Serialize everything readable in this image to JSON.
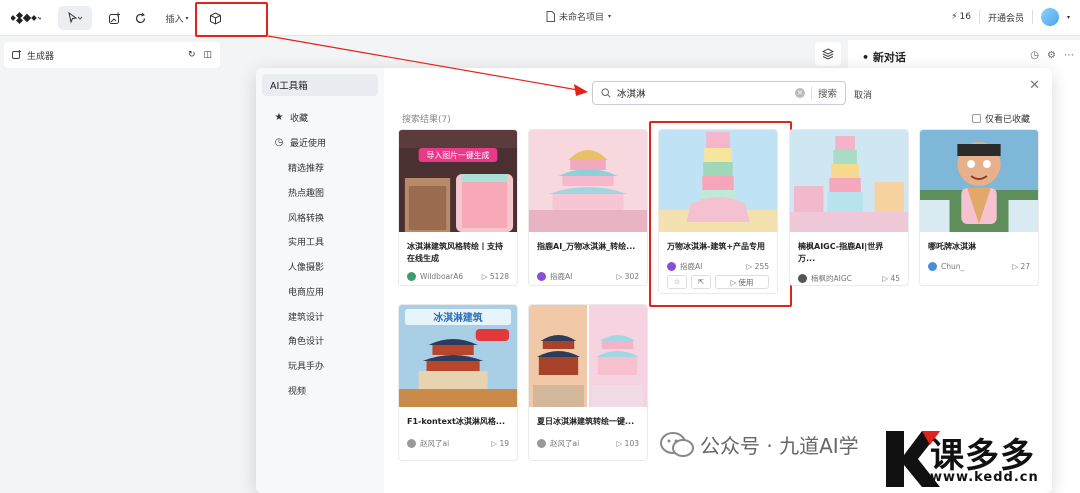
{
  "topbar": {
    "insert_label": "插入",
    "project_title": "未命名项目",
    "credits": "16",
    "vip_label": "开通会员"
  },
  "generator": {
    "label": "生成器"
  },
  "chat": {
    "title": "新对话"
  },
  "modal": {
    "sidebar_title": "AI工具箱",
    "sidebar_items": [
      {
        "label": "收藏",
        "icon": "star-icon"
      },
      {
        "label": "最近使用",
        "icon": "clock-icon"
      },
      {
        "label": "精选推荐"
      },
      {
        "label": "热点趣图"
      },
      {
        "label": "风格转换"
      },
      {
        "label": "实用工具"
      },
      {
        "label": "人像摄影"
      },
      {
        "label": "电商应用"
      },
      {
        "label": "建筑设计"
      },
      {
        "label": "角色设计"
      },
      {
        "label": "玩具手办"
      },
      {
        "label": "视频"
      }
    ],
    "search": {
      "value": "冰淇淋",
      "button": "搜索"
    },
    "cancel": "取消",
    "results_label": "搜索结果(7)",
    "only_favorites": "仅看已收藏",
    "cards": [
      {
        "title": "冰淇淋建筑风格转绘丨支持在线生成",
        "author": "WildboarA6",
        "plays": "5128",
        "thumb_text": "导入图片一键生成"
      },
      {
        "title": "指鹿AI_万物冰淇淋_转绘...",
        "author": "指鹿AI",
        "plays": "302"
      },
      {
        "title": "万物冰淇淋-建筑+产品专用",
        "author": "指鹿AI",
        "plays": "255",
        "use": "使用"
      },
      {
        "title": "楠枫AIGC-指鹿AI|世界万...",
        "author": "楠枫的AIGC",
        "plays": "45"
      },
      {
        "title": "哪吒牌冰淇淋",
        "author": "Chun_",
        "plays": "27"
      },
      {
        "title": "F1-kontext冰淇淋风格...",
        "author": "赵风了ai",
        "plays": "19",
        "thumb_text": "冰淇淋建筑"
      },
      {
        "title": "夏日冰淇淋建筑转绘一键...",
        "author": "赵风了ai",
        "plays": "103"
      }
    ]
  },
  "watermark": {
    "wechat": "公众号 · 九道AI学",
    "brand": "课多多",
    "url": "www.kedd.cn"
  },
  "colors": {
    "highlight": "#e2231a",
    "accent": "#2f7bf5"
  }
}
